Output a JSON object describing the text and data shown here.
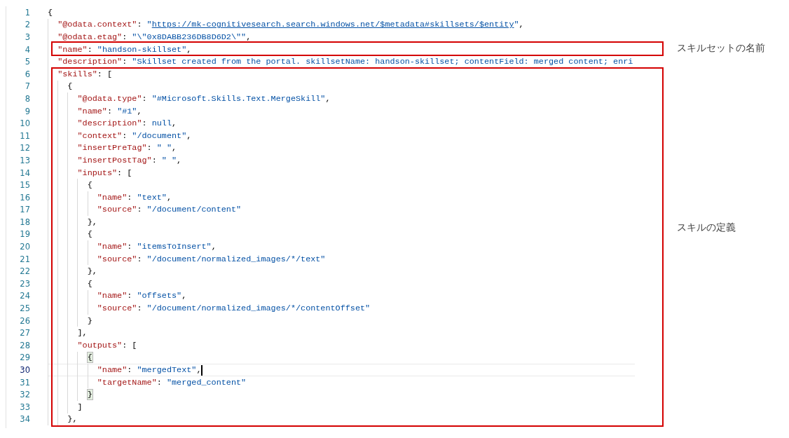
{
  "editor": {
    "lines": [
      {
        "number": "1",
        "current": false,
        "tokens": [
          {
            "kind": "punct",
            "text": "{"
          }
        ]
      },
      {
        "number": "2",
        "current": false,
        "tokens": [
          {
            "kind": "key",
            "text": "  \"@odata.context\""
          },
          {
            "kind": "punct",
            "text": ": "
          },
          {
            "kind": "string",
            "text": "\""
          },
          {
            "kind": "link",
            "text": "https://mk-cognitivesearch.search.windows.net/$metadata#skillsets/$entity"
          },
          {
            "kind": "string",
            "text": "\""
          },
          {
            "kind": "punct",
            "text": ","
          }
        ]
      },
      {
        "number": "3",
        "current": false,
        "tokens": [
          {
            "kind": "key",
            "text": "  \"@odata.etag\""
          },
          {
            "kind": "punct",
            "text": ": "
          },
          {
            "kind": "string",
            "text": "\"\\\"0x8DABB236DB8D6D2\\\"\""
          },
          {
            "kind": "punct",
            "text": ","
          }
        ]
      },
      {
        "number": "4",
        "current": false,
        "tokens": [
          {
            "kind": "key",
            "text": "  \"name\""
          },
          {
            "kind": "punct",
            "text": ": "
          },
          {
            "kind": "string",
            "text": "\"handson-skillset\""
          },
          {
            "kind": "punct",
            "text": ","
          }
        ]
      },
      {
        "number": "5",
        "current": false,
        "tokens": [
          {
            "kind": "key",
            "text": "  \"description\""
          },
          {
            "kind": "punct",
            "text": ": "
          },
          {
            "kind": "string",
            "text": "\"Skillset created from the portal. skillsetName: handson-skillset; contentField: merged content; enri"
          }
        ]
      },
      {
        "number": "6",
        "current": false,
        "tokens": [
          {
            "kind": "key",
            "text": "  \"skills\""
          },
          {
            "kind": "punct",
            "text": ": ["
          }
        ]
      },
      {
        "number": "7",
        "current": false,
        "tokens": [
          {
            "kind": "punct",
            "text": "    {"
          }
        ]
      },
      {
        "number": "8",
        "current": false,
        "tokens": [
          {
            "kind": "key",
            "text": "      \"@odata.type\""
          },
          {
            "kind": "punct",
            "text": ": "
          },
          {
            "kind": "string",
            "text": "\"#Microsoft.Skills.Text.MergeSkill\""
          },
          {
            "kind": "punct",
            "text": ","
          }
        ]
      },
      {
        "number": "9",
        "current": false,
        "tokens": [
          {
            "kind": "key",
            "text": "      \"name\""
          },
          {
            "kind": "punct",
            "text": ": "
          },
          {
            "kind": "string",
            "text": "\"#1\""
          },
          {
            "kind": "punct",
            "text": ","
          }
        ]
      },
      {
        "number": "10",
        "current": false,
        "tokens": [
          {
            "kind": "key",
            "text": "      \"description\""
          },
          {
            "kind": "punct",
            "text": ": "
          },
          {
            "kind": "null",
            "text": "null"
          },
          {
            "kind": "punct",
            "text": ","
          }
        ]
      },
      {
        "number": "11",
        "current": false,
        "tokens": [
          {
            "kind": "key",
            "text": "      \"context\""
          },
          {
            "kind": "punct",
            "text": ": "
          },
          {
            "kind": "string",
            "text": "\"/document\""
          },
          {
            "kind": "punct",
            "text": ","
          }
        ]
      },
      {
        "number": "12",
        "current": false,
        "tokens": [
          {
            "kind": "key",
            "text": "      \"insertPreTag\""
          },
          {
            "kind": "punct",
            "text": ": "
          },
          {
            "kind": "string",
            "text": "\" \""
          },
          {
            "kind": "punct",
            "text": ","
          }
        ]
      },
      {
        "number": "13",
        "current": false,
        "tokens": [
          {
            "kind": "key",
            "text": "      \"insertPostTag\""
          },
          {
            "kind": "punct",
            "text": ": "
          },
          {
            "kind": "string",
            "text": "\" \""
          },
          {
            "kind": "punct",
            "text": ","
          }
        ]
      },
      {
        "number": "14",
        "current": false,
        "tokens": [
          {
            "kind": "key",
            "text": "      \"inputs\""
          },
          {
            "kind": "punct",
            "text": ": ["
          }
        ]
      },
      {
        "number": "15",
        "current": false,
        "tokens": [
          {
            "kind": "punct",
            "text": "        {"
          }
        ]
      },
      {
        "number": "16",
        "current": false,
        "tokens": [
          {
            "kind": "key",
            "text": "          \"name\""
          },
          {
            "kind": "punct",
            "text": ": "
          },
          {
            "kind": "string",
            "text": "\"text\""
          },
          {
            "kind": "punct",
            "text": ","
          }
        ]
      },
      {
        "number": "17",
        "current": false,
        "tokens": [
          {
            "kind": "key",
            "text": "          \"source\""
          },
          {
            "kind": "punct",
            "text": ": "
          },
          {
            "kind": "string",
            "text": "\"/document/content\""
          }
        ]
      },
      {
        "number": "18",
        "current": false,
        "tokens": [
          {
            "kind": "punct",
            "text": "        },"
          }
        ]
      },
      {
        "number": "19",
        "current": false,
        "tokens": [
          {
            "kind": "punct",
            "text": "        {"
          }
        ]
      },
      {
        "number": "20",
        "current": false,
        "tokens": [
          {
            "kind": "key",
            "text": "          \"name\""
          },
          {
            "kind": "punct",
            "text": ": "
          },
          {
            "kind": "string",
            "text": "\"itemsToInsert\""
          },
          {
            "kind": "punct",
            "text": ","
          }
        ]
      },
      {
        "number": "21",
        "current": false,
        "tokens": [
          {
            "kind": "key",
            "text": "          \"source\""
          },
          {
            "kind": "punct",
            "text": ": "
          },
          {
            "kind": "string",
            "text": "\"/document/normalized_images/*/text\""
          }
        ]
      },
      {
        "number": "22",
        "current": false,
        "tokens": [
          {
            "kind": "punct",
            "text": "        },"
          }
        ]
      },
      {
        "number": "23",
        "current": false,
        "tokens": [
          {
            "kind": "punct",
            "text": "        {"
          }
        ]
      },
      {
        "number": "24",
        "current": false,
        "tokens": [
          {
            "kind": "key",
            "text": "          \"name\""
          },
          {
            "kind": "punct",
            "text": ": "
          },
          {
            "kind": "string",
            "text": "\"offsets\""
          },
          {
            "kind": "punct",
            "text": ","
          }
        ]
      },
      {
        "number": "25",
        "current": false,
        "tokens": [
          {
            "kind": "key",
            "text": "          \"source\""
          },
          {
            "kind": "punct",
            "text": ": "
          },
          {
            "kind": "string",
            "text": "\"/document/normalized_images/*/contentOffset\""
          }
        ]
      },
      {
        "number": "26",
        "current": false,
        "tokens": [
          {
            "kind": "punct",
            "text": "        }"
          }
        ]
      },
      {
        "number": "27",
        "current": false,
        "tokens": [
          {
            "kind": "punct",
            "text": "      ],"
          }
        ]
      },
      {
        "number": "28",
        "current": false,
        "tokens": [
          {
            "kind": "key",
            "text": "      \"outputs\""
          },
          {
            "kind": "punct",
            "text": ": ["
          }
        ]
      },
      {
        "number": "29",
        "current": false,
        "tokens": [
          {
            "kind": "match",
            "text": "        {"
          }
        ]
      },
      {
        "number": "30",
        "current": true,
        "tokens": [
          {
            "kind": "key",
            "text": "          \"name\""
          },
          {
            "kind": "punct",
            "text": ": "
          },
          {
            "kind": "string",
            "text": "\"mergedText\""
          },
          {
            "kind": "punct",
            "text": ","
          }
        ]
      },
      {
        "number": "31",
        "current": false,
        "tokens": [
          {
            "kind": "key",
            "text": "          \"targetName\""
          },
          {
            "kind": "punct",
            "text": ": "
          },
          {
            "kind": "string",
            "text": "\"merged_content\""
          }
        ]
      },
      {
        "number": "32",
        "current": false,
        "tokens": [
          {
            "kind": "match",
            "text": "        }"
          }
        ]
      },
      {
        "number": "33",
        "current": false,
        "tokens": [
          {
            "kind": "punct",
            "text": "      ]"
          }
        ]
      },
      {
        "number": "34",
        "current": false,
        "tokens": [
          {
            "kind": "punct",
            "text": "    },"
          }
        ]
      }
    ]
  },
  "annotations": [
    {
      "label": "スキルセットの名前"
    },
    {
      "label": "スキルの定義"
    }
  ]
}
